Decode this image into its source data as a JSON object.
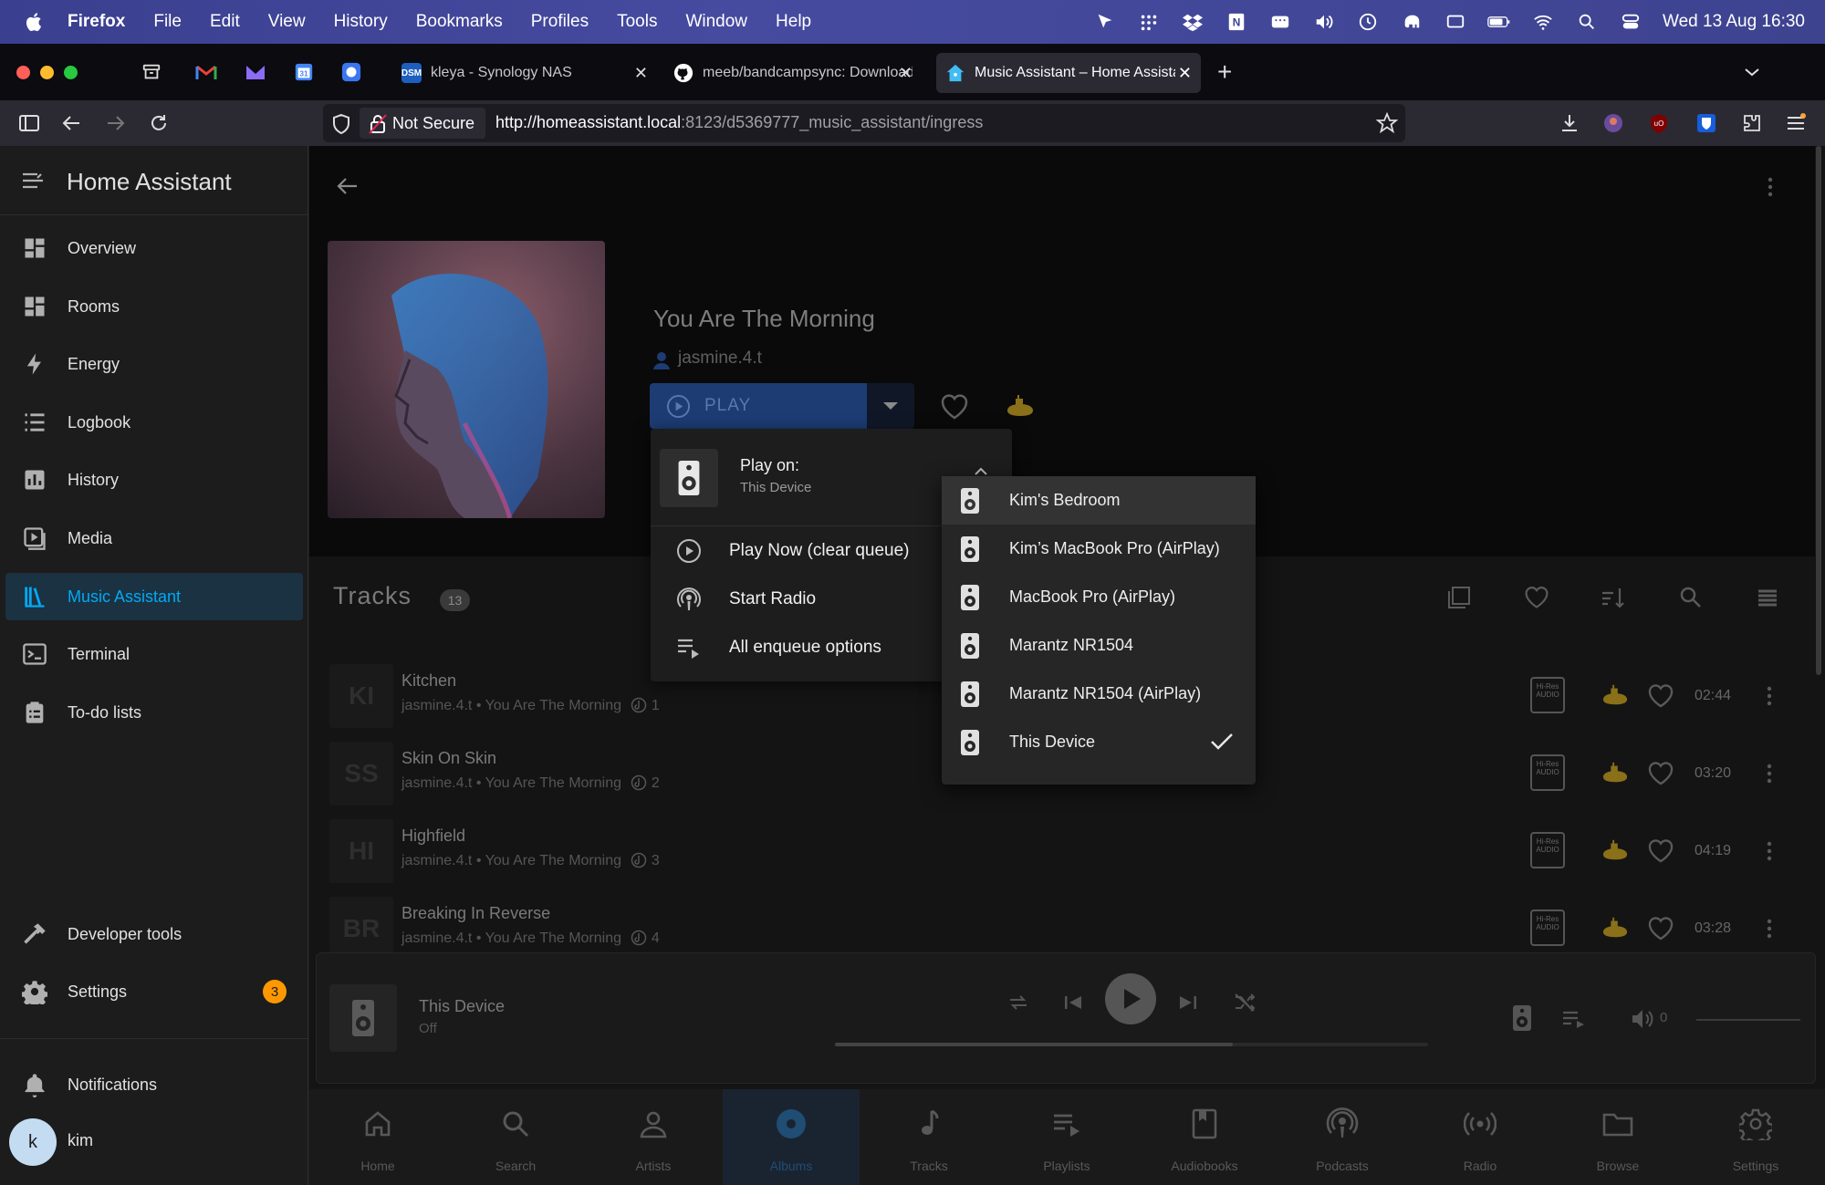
{
  "menubar": {
    "app": "Firefox",
    "items": [
      "File",
      "Edit",
      "View",
      "History",
      "Bookmarks",
      "Profiles",
      "Tools",
      "Window",
      "Help"
    ],
    "clock": "Wed 13 Aug  16:30"
  },
  "tabs": [
    {
      "title": "kleya - Synology NAS",
      "favicon": "DSM"
    },
    {
      "title": "meeb/bandcampsync: Downloads",
      "favicon": "github-icon"
    },
    {
      "title": "Music Assistant – Home Assistant",
      "favicon": "home-assistant-icon",
      "active": true
    }
  ],
  "pinned_tabs": [
    "archive",
    "gmail",
    "proton-mail",
    "calendar",
    "signal"
  ],
  "urlbar": {
    "security": "Not Secure",
    "host": "http://homeassistant.local",
    "path": ":8123/d5369777_music_assistant/ingress"
  },
  "sidebar": {
    "title": "Home Assistant",
    "items": [
      {
        "label": "Overview",
        "icon": "dashboard-icon"
      },
      {
        "label": "Rooms",
        "icon": "dashboard-icon"
      },
      {
        "label": "Energy",
        "icon": "lightning-icon"
      },
      {
        "label": "Logbook",
        "icon": "list-icon"
      },
      {
        "label": "History",
        "icon": "chart-icon"
      },
      {
        "label": "Media",
        "icon": "media-icon"
      },
      {
        "label": "Music Assistant",
        "icon": "library-icon",
        "active": true
      },
      {
        "label": "Terminal",
        "icon": "terminal-icon"
      },
      {
        "label": "To-do lists",
        "icon": "clipboard-icon"
      }
    ],
    "bottom": [
      {
        "label": "Developer tools",
        "icon": "hammer-icon"
      },
      {
        "label": "Settings",
        "icon": "gear-icon",
        "badge": "3"
      }
    ],
    "notifications": "Notifications",
    "user": {
      "initial": "k",
      "name": "kim"
    }
  },
  "album": {
    "title": "You Are The Morning",
    "artist": "jasmine.4.t",
    "play_label": "PLAY"
  },
  "tracks": {
    "title": "Tracks",
    "count": "13",
    "rows": [
      {
        "initials": "KI",
        "name": "Kitchen",
        "sub": "jasmine.4.t • You Are The Morning",
        "disc": "1",
        "duration": "02:44"
      },
      {
        "initials": "SS",
        "name": "Skin On Skin",
        "sub": "jasmine.4.t • You Are The Morning",
        "disc": "2",
        "duration": "03:20"
      },
      {
        "initials": "HI",
        "name": "Highfield",
        "sub": "jasmine.4.t • You Are The Morning",
        "disc": "3",
        "duration": "04:19"
      },
      {
        "initials": "BR",
        "name": "Breaking In Reverse",
        "sub": "jasmine.4.t • You Are The Morning",
        "disc": "4",
        "duration": "03:28"
      }
    ],
    "hires_label": "Hi-Res AUDIO"
  },
  "play_menu": {
    "play_on": "Play on:",
    "device": "This Device",
    "items": [
      {
        "label": "Play Now (clear queue)",
        "icon": "play-circle-icon"
      },
      {
        "label": "Start Radio",
        "icon": "radio-icon"
      },
      {
        "label": "All enqueue options",
        "icon": "queue-icon"
      }
    ]
  },
  "devices": [
    {
      "name": "Kim's Bedroom"
    },
    {
      "name": "Kim’s MacBook Pro (AirPlay)"
    },
    {
      "name": "MacBook Pro (AirPlay)"
    },
    {
      "name": "Marantz NR1504"
    },
    {
      "name": "Marantz NR1504 (AirPlay)"
    },
    {
      "name": "This Device",
      "selected": true
    }
  ],
  "player": {
    "device": "This Device",
    "state": "Off",
    "volume": "0",
    "progress": 0.67
  },
  "bottom_nav": [
    {
      "label": "Home",
      "icon": "home-icon"
    },
    {
      "label": "Search",
      "icon": "search-icon"
    },
    {
      "label": "Artists",
      "icon": "person-icon"
    },
    {
      "label": "Albums",
      "icon": "album-icon",
      "active": true
    },
    {
      "label": "Tracks",
      "icon": "music-note-icon"
    },
    {
      "label": "Playlists",
      "icon": "playlist-icon"
    },
    {
      "label": "Audiobooks",
      "icon": "book-icon"
    },
    {
      "label": "Podcasts",
      "icon": "podcast-icon"
    },
    {
      "label": "Radio",
      "icon": "radio-icon"
    },
    {
      "label": "Browse",
      "icon": "folder-icon"
    },
    {
      "label": "Settings",
      "icon": "gear-icon"
    }
  ],
  "colors": {
    "accent": "#03a9f4",
    "play_button": "#1d3c74",
    "badge": "#ff9800",
    "provider": "#8a7018"
  }
}
